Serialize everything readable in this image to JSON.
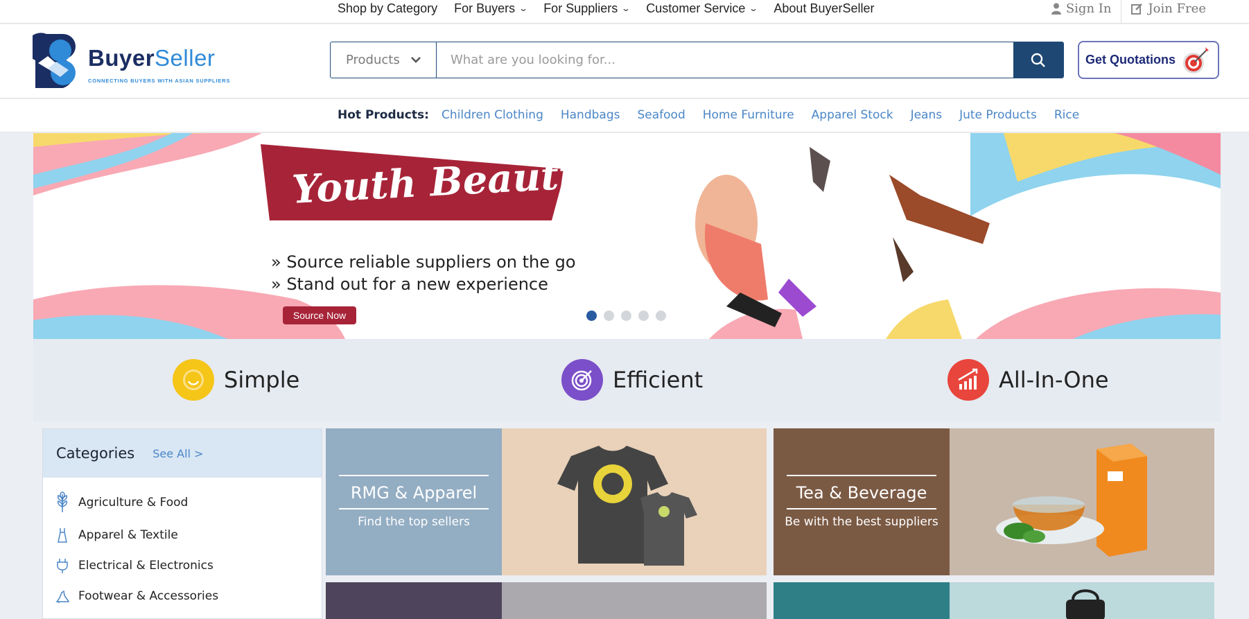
{
  "topnav": {
    "items": [
      {
        "label": "Shop by Category",
        "dropdown": false
      },
      {
        "label": "For Buyers",
        "dropdown": true
      },
      {
        "label": "For Suppliers",
        "dropdown": true
      },
      {
        "label": "Customer Service",
        "dropdown": true
      },
      {
        "label": "About BuyerSeller",
        "dropdown": false
      }
    ],
    "sign_in": "Sign In",
    "join_free": "Join Free"
  },
  "logo": {
    "word_dark": "Buyer",
    "word_light": "Seller",
    "tagline": "CONNECTING BUYERS WITH ASIAN SUPPLIERS"
  },
  "search": {
    "category": "Products",
    "placeholder": "What are you looking for..."
  },
  "quote_button": "Get Quotations",
  "hot_products": {
    "label": "Hot Products:",
    "items": [
      "Children Clothing",
      "Handbags",
      "Seafood",
      "Home Furniture",
      "Apparel Stock",
      "Jeans",
      "Jute Products",
      "Rice"
    ]
  },
  "banner": {
    "title": "Youth Beautiful",
    "bullet1": "» Source reliable suppliers on the go",
    "bullet2": "» Stand out for a new experience",
    "button": "Source Now",
    "slide_count": 5,
    "active_slide": 1
  },
  "features": [
    {
      "label": "Simple",
      "color": "#f5c518"
    },
    {
      "label": "Efficient",
      "color": "#7b4fc9"
    },
    {
      "label": "All-In-One",
      "color": "#e8453c"
    }
  ],
  "categories": {
    "title": "Categories",
    "see_all": "See All >",
    "items": [
      {
        "label": "Agriculture & Food",
        "icon": "wheat-icon"
      },
      {
        "label": "Apparel & Textile",
        "icon": "dress-icon"
      },
      {
        "label": "Electrical & Electronics",
        "icon": "plug-icon"
      },
      {
        "label": "Footwear & Accessories",
        "icon": "shoe-icon"
      }
    ]
  },
  "tiles": [
    {
      "heading": "RMG & Apparel",
      "sub": "Find the top sellers",
      "color": "#93adc3"
    },
    {
      "heading": "Tea & Beverage",
      "sub": "Be with the best suppliers",
      "color": "#7b5a44"
    }
  ],
  "colors": {
    "navy": "#1e4873",
    "link": "#4a86c7",
    "banner_red": "#a72438"
  }
}
